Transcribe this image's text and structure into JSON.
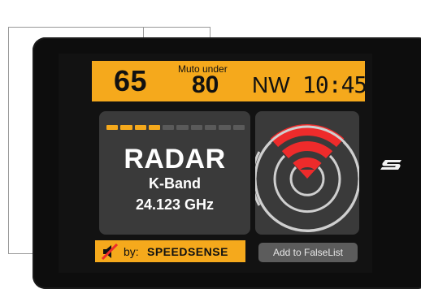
{
  "topbar": {
    "current_speed": "65",
    "mute_under_label": "Muto under",
    "mute_under_value": "80",
    "heading": "NW",
    "clock": "10:45"
  },
  "alert": {
    "signal_strength": {
      "filled": 4,
      "total": 10
    },
    "type": "RADAR",
    "band": "K-Band",
    "frequency": "24.123 GHz"
  },
  "credit": {
    "prefix": "by:",
    "brand": "SPEEDSENSE",
    "icon": "mute-speaker-icon"
  },
  "radar_graphic": {
    "icon": "radar-rings-icon",
    "signal_color": "#ee2b2b"
  },
  "falselist": {
    "label": "Add to FalseList"
  },
  "device": {
    "logo_icon": "brand-s-logo-icon"
  },
  "colors": {
    "accent": "#f5a91c",
    "panel": "#3a3a3a",
    "bezel": "#0d0d0d",
    "alert_red": "#ee2b2b"
  }
}
